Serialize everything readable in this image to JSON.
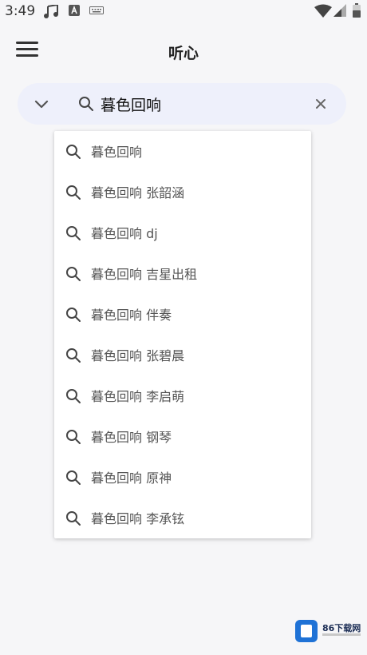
{
  "status_bar": {
    "time": "3:49",
    "icons": [
      "music-note-icon",
      "app-notification-icon",
      "keyboard-icon",
      "wifi-icon",
      "signal-icon",
      "battery-icon"
    ]
  },
  "app_bar": {
    "title": "听心"
  },
  "search": {
    "value": "暮色回响"
  },
  "suggestions": [
    "暮色回响",
    "暮色回响 张韶涵",
    "暮色回响 dj",
    "暮色回响 吉星出租",
    "暮色回响 伴奏",
    "暮色回响 张碧晨",
    "暮色回响 李启萌",
    "暮色回响 钢琴",
    "暮色回响 原神",
    "暮色回响 李承铉"
  ],
  "watermark": {
    "text": "86下载网"
  },
  "colors": {
    "search_bar_bg": "#eef0fb",
    "background": "#f6f6f8",
    "watermark_blue": "#1f72d6"
  }
}
